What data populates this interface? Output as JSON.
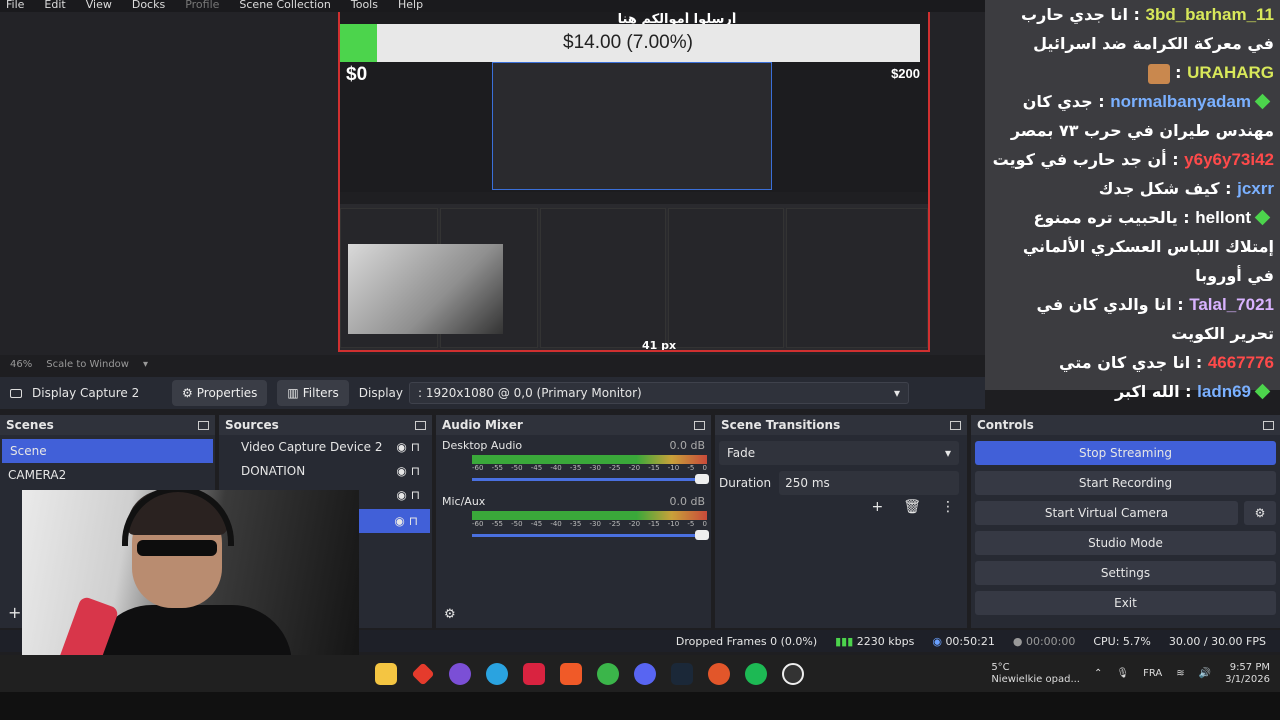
{
  "menu": [
    "File",
    "Edit",
    "View",
    "Docks",
    "Profile",
    "Scene Collection",
    "Tools",
    "Help"
  ],
  "overlay": {
    "banner": "أرسلوا أموالكم هنا",
    "progress_text": "$14.00 (7.00%)",
    "progress_fraction": 0.07,
    "goal_min": "$0",
    "goal_max": "$200",
    "px_label": "41 px"
  },
  "chat": [
    {
      "name": "3bd_barham_11",
      "color": "#d8e85a",
      "text": "انا جدي حارب في معركة الكرامة ضد اسرائيل",
      "badge": false
    },
    {
      "name": "URAHARG",
      "color": "#d8e85a",
      "text": "",
      "badge": false
    },
    {
      "name": "normalbanyadam",
      "color": "#7ab0ff",
      "text": "جدي كان مهندس طيران في حرب ٧٣ بمصر",
      "badge": true
    },
    {
      "name": "y6y6y73i42",
      "color": "#ff4a4a",
      "text": "أن جد حارب في كويت",
      "badge": false
    },
    {
      "name": "jcxrr",
      "color": "#7ab0ff",
      "text": "كيف شكل جدك",
      "badge": false
    },
    {
      "name": "hellont",
      "color": "#ffffff",
      "text": "يالحبيب تره ممنوع إمتلاك اللباس العسكري الألماني في أوروبا",
      "badge": true
    },
    {
      "name": "Talal_7021",
      "color": "#d9b3ff",
      "text": "انا والدي كان في تحرير الكويت",
      "badge": false
    },
    {
      "name": "4667776",
      "color": "#ff4a4a",
      "text": "انا جدي كان متي",
      "badge": false
    },
    {
      "name": "ladn69",
      "color": "#7ab0ff",
      "text": "الله اكبر",
      "badge": true
    }
  ],
  "zoom": {
    "percent": "46%",
    "mode": "Scale to Window"
  },
  "source_bar": {
    "source_name": "Display Capture 2",
    "properties": "Properties",
    "filters": "Filters",
    "display_label": "Display",
    "display_value": ": 1920x1080 @ 0,0 (Primary Monitor)"
  },
  "scenes": {
    "title": "Scenes",
    "items": [
      "Scene",
      "CAMERA2"
    ]
  },
  "sources": {
    "title": "Sources",
    "items": [
      "Video Capture Device 2",
      "DONATION"
    ]
  },
  "mixer": {
    "title": "Audio Mixer",
    "ticks": [
      "-60",
      "-55",
      "-50",
      "-45",
      "-40",
      "-35",
      "-30",
      "-25",
      "-20",
      "-15",
      "-10",
      "-5",
      "0"
    ],
    "channels": [
      {
        "name": "Desktop Audio",
        "db": "0.0 dB"
      },
      {
        "name": "Mic/Aux",
        "db": "0.0 dB"
      }
    ]
  },
  "transitions": {
    "title": "Scene Transitions",
    "type": "Fade",
    "duration_label": "Duration",
    "duration": "250 ms"
  },
  "controls": {
    "title": "Controls",
    "buttons": [
      "Stop Streaming",
      "Start Recording",
      "Start Virtual Camera",
      "Studio Mode",
      "Settings",
      "Exit"
    ]
  },
  "status": {
    "dropped": "Dropped Frames 0 (0.0%)",
    "bitrate": "2230 kbps",
    "stream_time": "00:50:21",
    "rec_time": "00:00:00",
    "cpu": "CPU: 5.7%",
    "fps": "30.00 / 30.00 FPS"
  },
  "taskbar": {
    "weather_temp": "5°C",
    "weather_desc": "Niewielkie opad...",
    "lang": "FRA",
    "time": "9:57 PM",
    "date": "3/1/2026"
  }
}
